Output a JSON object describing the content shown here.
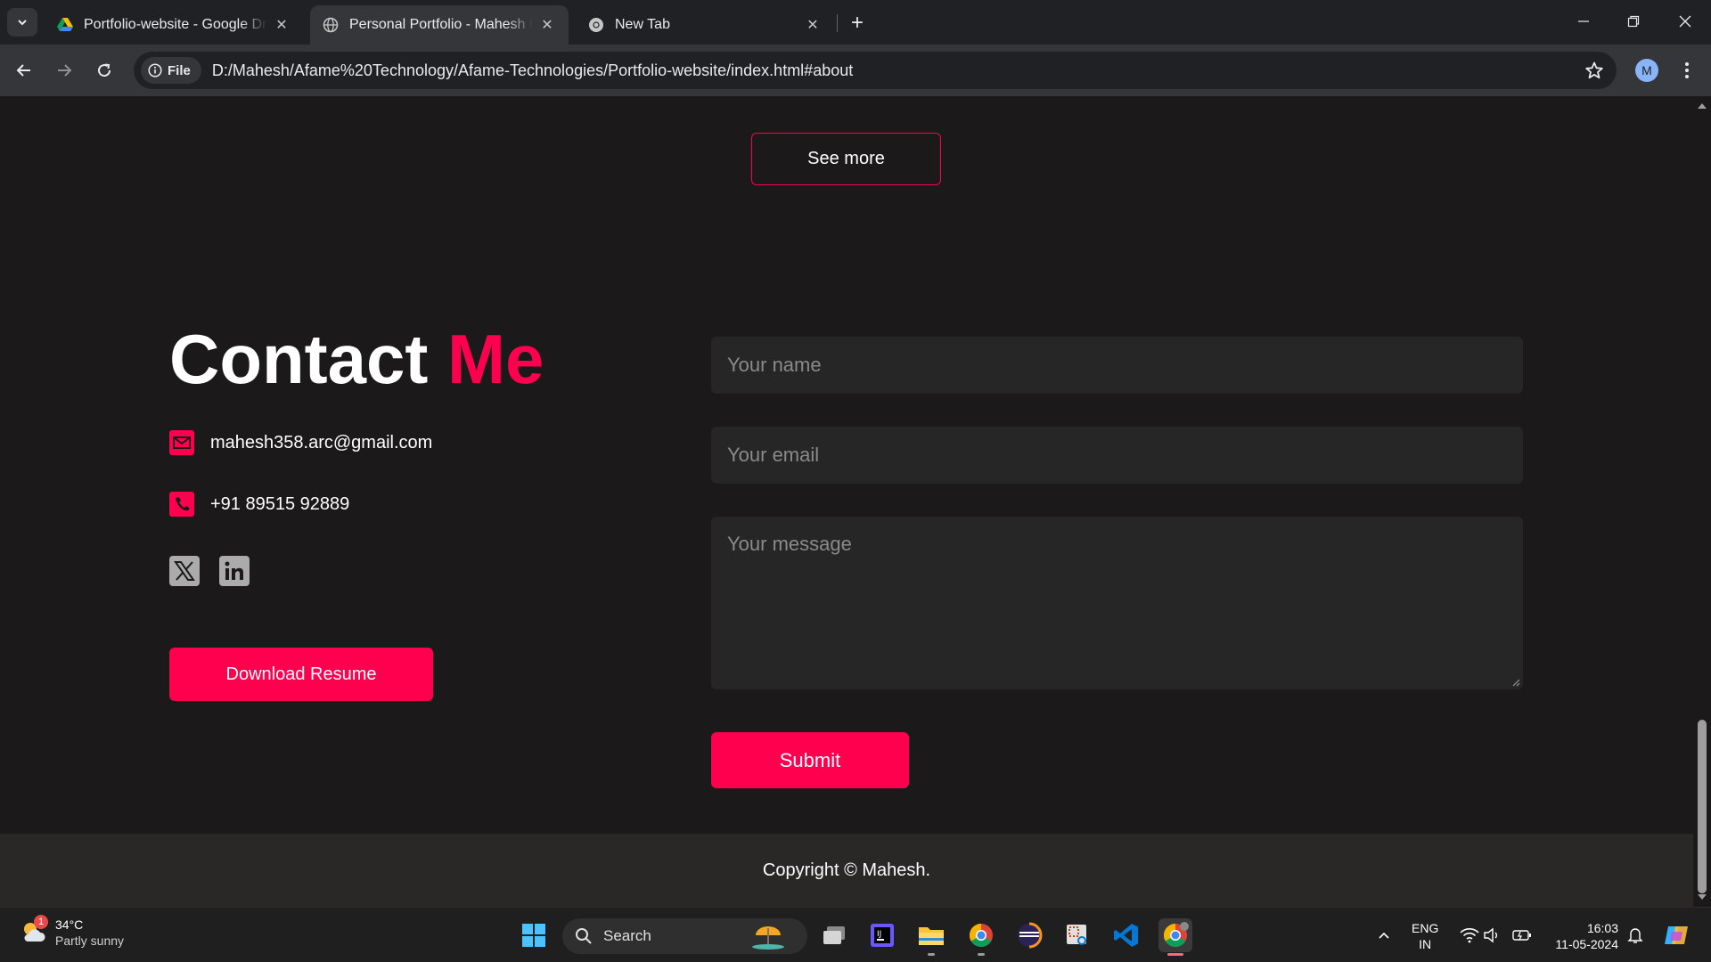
{
  "browser": {
    "tabs": [
      {
        "title": "Portfolio-website - Google Drive",
        "favicon": "google-drive-icon",
        "active": false
      },
      {
        "title": "Personal Portfolio - Mahesh Chavan",
        "favicon": "globe-icon",
        "active": true
      },
      {
        "title": "New Tab",
        "favicon": "chrome-icon",
        "active": false
      }
    ],
    "site_chip": "File",
    "url": "D:/Mahesh/Afame%20Technology/Afame-Technologies/Portfolio-website/index.html#about",
    "profile_initial": "M"
  },
  "page": {
    "see_more_label": "See more",
    "contact": {
      "title_main": "Contact",
      "title_accent": "Me",
      "email": "mahesh358.arc@gmail.com",
      "phone": "+91 89515 92889",
      "download_label": "Download Resume"
    },
    "form": {
      "name_placeholder": "Your name",
      "email_placeholder": "Your email",
      "message_placeholder": "Your message",
      "submit_label": "Submit"
    },
    "footer": "Copyright © Mahesh.",
    "colors": {
      "accent": "#ff004f",
      "background": "#1b1919",
      "field": "#262626",
      "footer": "#2a2727"
    }
  },
  "taskbar": {
    "weather_temp": "34°C",
    "weather_condition": "Partly sunny",
    "weather_badge": "1",
    "search_label": "Search",
    "lang_line1": "ENG",
    "lang_line2": "IN",
    "time": "16:03",
    "date": "11-05-2024"
  }
}
